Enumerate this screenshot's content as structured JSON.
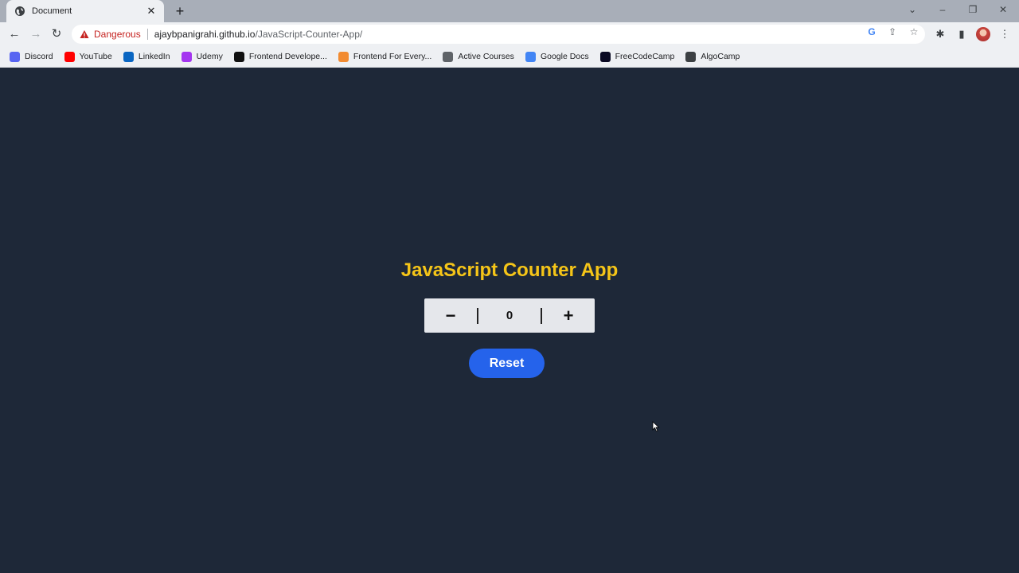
{
  "browser": {
    "tab": {
      "title": "Document",
      "close": "✕"
    },
    "new_tab": "+",
    "window_controls": {
      "tab_search": "⌄",
      "minimize": "–",
      "restore": "❐",
      "close": "✕"
    },
    "nav": {
      "back": "←",
      "forward": "→",
      "reload": "↻"
    },
    "omnibox": {
      "security_label": "Dangerous",
      "url_host": "ajaybpanigrahi.github.io",
      "url_path": "/JavaScript-Counter-App/"
    },
    "toolbar_icons": {
      "google": "G",
      "share": "⇪",
      "bookmark": "☆",
      "extensions": "✱",
      "side_panel": "▮",
      "menu": "⋮"
    },
    "bookmarks": [
      {
        "label": "Discord",
        "icon": "discord-icon",
        "color": "#5865f2"
      },
      {
        "label": "YouTube",
        "icon": "youtube-icon",
        "color": "#ff0000"
      },
      {
        "label": "LinkedIn",
        "icon": "linkedin-icon",
        "color": "#0a66c2"
      },
      {
        "label": "Udemy",
        "icon": "udemy-icon",
        "color": "#a435f0"
      },
      {
        "label": "Frontend Develope...",
        "icon": "notion-icon",
        "color": "#111111"
      },
      {
        "label": "Frontend For Every...",
        "icon": "frontend-icon",
        "color": "#f28b30"
      },
      {
        "label": "Active Courses",
        "icon": "courses-icon",
        "color": "#5f6368"
      },
      {
        "label": "Google Docs",
        "icon": "google-docs-icon",
        "color": "#4285f4"
      },
      {
        "label": "FreeCodeCamp",
        "icon": "freecodecamp-icon",
        "color": "#0a0a23"
      },
      {
        "label": "AlgoCamp",
        "icon": "globe-icon",
        "color": "#3c4043"
      }
    ]
  },
  "app": {
    "title": "JavaScript Counter App",
    "decrement_label": "−",
    "increment_label": "+",
    "count": "0",
    "reset_label": "Reset",
    "colors": {
      "background": "#1e2838",
      "title": "#f5c518",
      "reset": "#2563eb",
      "counter_bg": "#e5e7eb"
    }
  }
}
